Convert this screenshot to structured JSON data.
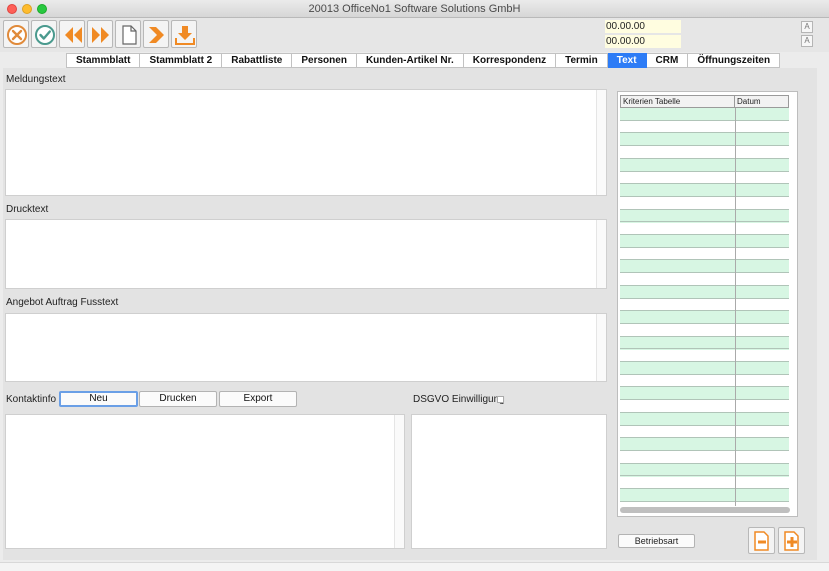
{
  "window": {
    "title": "20013 OfficeNo1 Software Solutions GmbH"
  },
  "toolbar": {
    "icons": [
      "cancel-icon",
      "confirm-icon",
      "first-record-icon",
      "previous-record-icon",
      "new-document-icon",
      "next-record-icon",
      "last-record-icon",
      "download-icon"
    ],
    "date1": "00.00.00",
    "date2": "00.00.00",
    "font_larger_label": "A",
    "font_smaller_label": "A"
  },
  "tabs": [
    {
      "label": "Stammblatt"
    },
    {
      "label": "Stammblatt 2"
    },
    {
      "label": "Rabattliste"
    },
    {
      "label": "Personen"
    },
    {
      "label": "Kunden-Artikel Nr."
    },
    {
      "label": "Korrespondenz"
    },
    {
      "label": "Termin"
    },
    {
      "label": "Text",
      "active": true
    },
    {
      "label": "CRM"
    },
    {
      "label": "Öffnungszeiten"
    }
  ],
  "form": {
    "meldungstext_label": "Meldungstext",
    "meldungstext_value": "",
    "drucktext_label": "Drucktext",
    "drucktext_value": "",
    "fusstext_label": "Angebot Auftrag Fusstext",
    "fusstext_value": "",
    "kontaktinfo_label": "Kontaktinfo",
    "neu_button": "Neu",
    "drucken_button": "Drucken",
    "export_button": "Export",
    "dsgvo_label": "DSGVO Einwilligung",
    "dsgvo_checked": false
  },
  "criteria_table": {
    "columns": [
      "Kriterien Tabelle",
      "Datum"
    ],
    "rows": []
  },
  "betriebsart_button": "Betriebsart",
  "colors": {
    "accent": "#2d7cf6",
    "orange": "#f08a24",
    "row_green": "#d7f6e3",
    "date_bg": "#fffde0"
  }
}
